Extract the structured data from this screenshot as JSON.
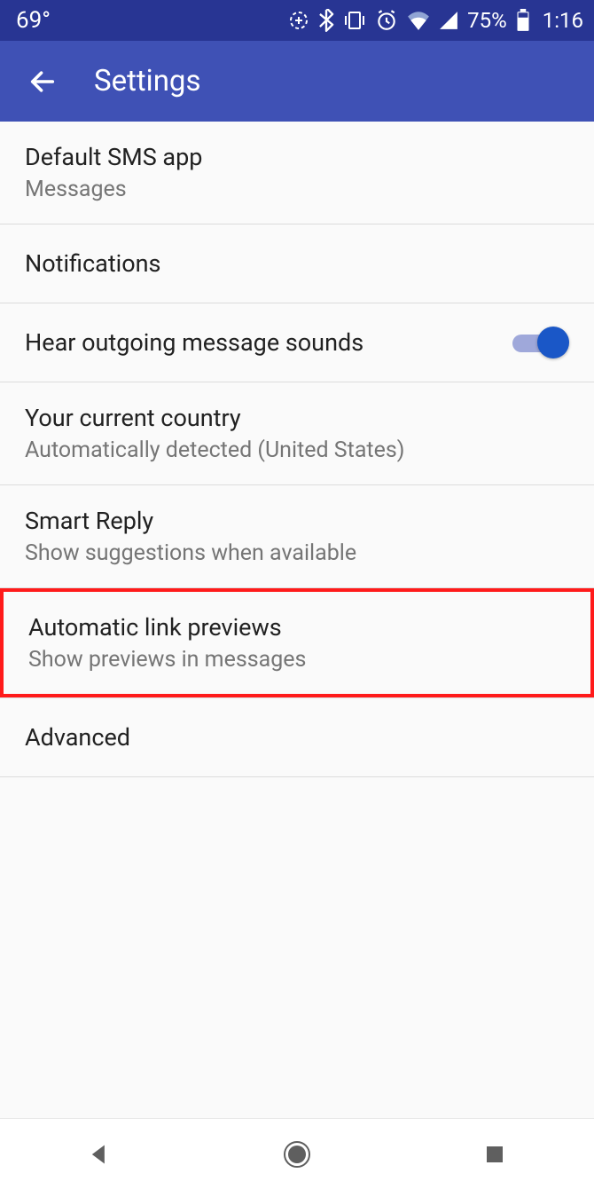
{
  "status": {
    "temperature": "69°",
    "battery": "75%",
    "time": "1:16"
  },
  "appbar": {
    "title": "Settings"
  },
  "settings": {
    "default_sms": {
      "title": "Default SMS app",
      "subtitle": "Messages"
    },
    "notifications": {
      "title": "Notifications"
    },
    "outgoing_sounds": {
      "title": "Hear outgoing message sounds",
      "enabled": true
    },
    "country": {
      "title": "Your current country",
      "subtitle": "Automatically detected (United States)"
    },
    "smart_reply": {
      "title": "Smart Reply",
      "subtitle": "Show suggestions when available"
    },
    "link_previews": {
      "title": "Automatic link previews",
      "subtitle": "Show previews in messages"
    },
    "advanced": {
      "title": "Advanced"
    }
  },
  "colors": {
    "status_bar": "#283593",
    "app_bar": "#3f51b5",
    "toggle_thumb": "#1a57c7",
    "highlight": "#ff1a1a"
  }
}
